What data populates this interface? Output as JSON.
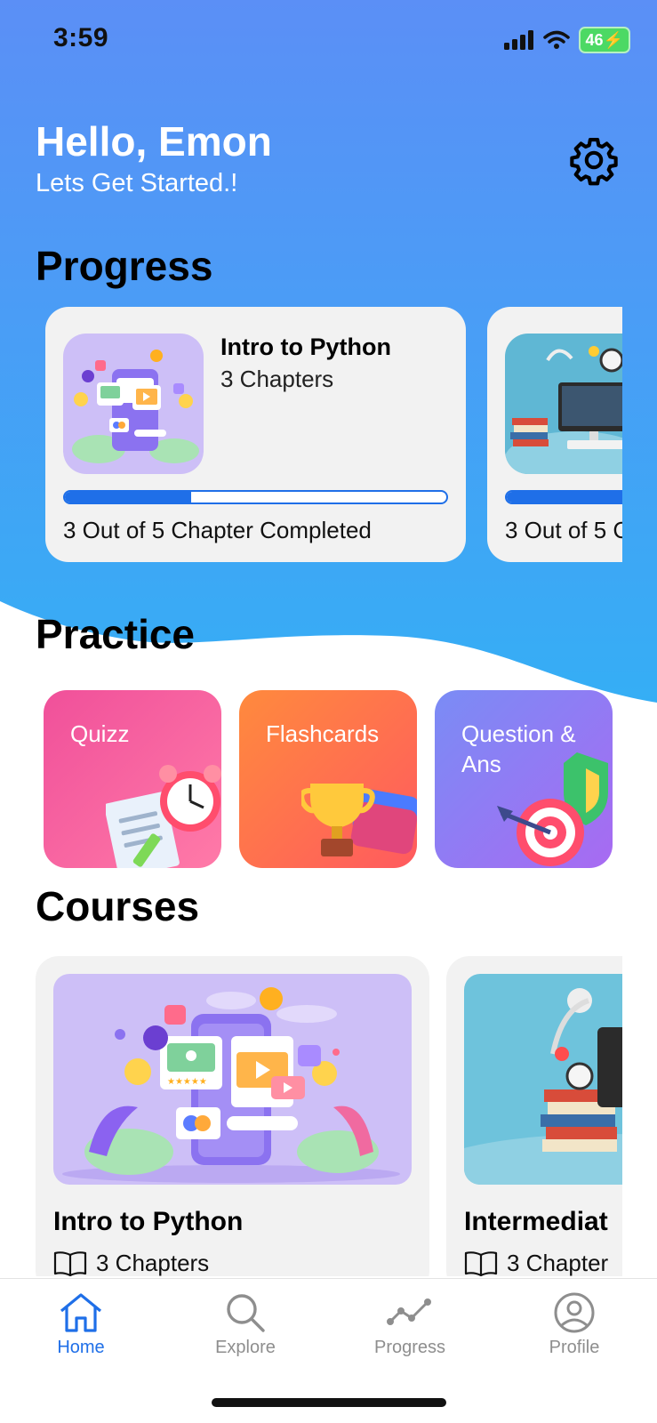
{
  "status_bar": {
    "time": "3:59",
    "battery": "46",
    "icons": [
      "signal-icon",
      "wifi-icon",
      "battery-icon"
    ]
  },
  "greeting": {
    "title": "Hello, Emon",
    "subtitle": "Lets Get Started.!"
  },
  "sections": {
    "progress": "Progress",
    "practice": "Practice",
    "courses": "Courses"
  },
  "progress_cards": [
    {
      "title": "Intro to Python",
      "subtitle": "3 Chapters",
      "status": "3 Out of 5 Chapter Completed",
      "progress": 0.33
    },
    {
      "title": "",
      "subtitle": "",
      "status": "3 Out of 5 C",
      "progress": 0.6
    }
  ],
  "practice": [
    {
      "label": "Quizz",
      "gradient": [
        "#f0509a",
        "#ff7aa8"
      ]
    },
    {
      "label": "Flashcards",
      "gradient": [
        "#ff8a3d",
        "#ff5a5f"
      ]
    },
    {
      "label": "Question & Ans",
      "gradient": [
        "#7a8cf5",
        "#a86af2"
      ]
    }
  ],
  "courses": [
    {
      "title": "Intro to Python",
      "chapters": "3 Chapters"
    },
    {
      "title": "Intermediat",
      "chapters": "3 Chapter"
    }
  ],
  "nav": [
    {
      "label": "Home",
      "icon": "home-icon",
      "active": true
    },
    {
      "label": "Explore",
      "icon": "search-icon",
      "active": false
    },
    {
      "label": "Progress",
      "icon": "chart-line-icon",
      "active": false
    },
    {
      "label": "Profile",
      "icon": "user-circle-icon",
      "active": false
    }
  ],
  "colors": {
    "accent": "#1f6fe8",
    "hero_top": "#5b8ff6",
    "hero_bottom": "#39a9f5",
    "muted": "#8e8e8e"
  }
}
